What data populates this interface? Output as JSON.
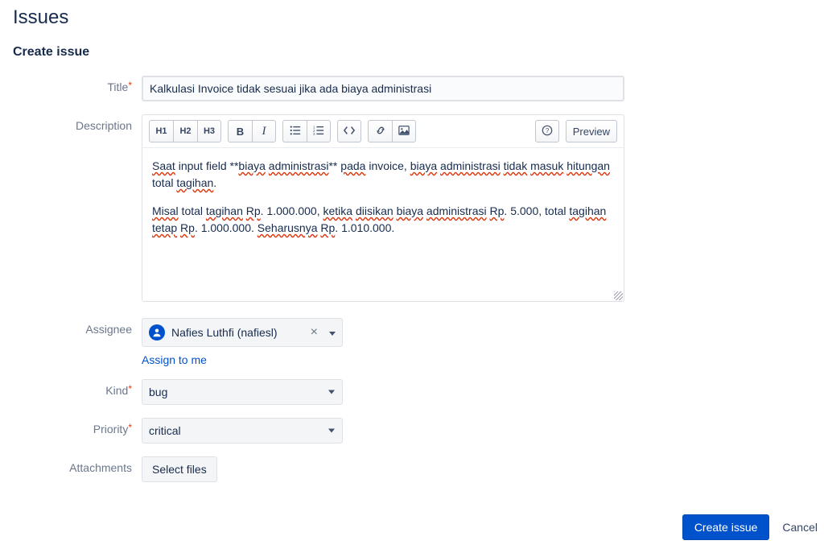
{
  "page": {
    "heading": "Issues",
    "section_title": "Create issue"
  },
  "form": {
    "title_label": "Title",
    "title_value": "Kalkulasi Invoice tidak sesuai jika ada biaya administrasi",
    "description_label": "Description",
    "description_text_p1": "Saat input field **biaya administrasi** pada invoice, biaya administrasi tidak masuk hitungan total tagihan.",
    "description_text_p2": "Misal total tagihan Rp. 1.000.000, ketika diisikan biaya administrasi Rp. 5.000, total tagihan tetap Rp. 1.000.000. Seharusnya Rp. 1.010.000.",
    "assignee_label": "Assignee",
    "assignee_value": "Nafies Luthfi (nafiesl)",
    "assign_to_me": "Assign to me",
    "kind_label": "Kind",
    "kind_value": "bug",
    "priority_label": "Priority",
    "priority_value": "critical",
    "attachments_label": "Attachments",
    "select_files_label": "Select files"
  },
  "toolbar": {
    "h1": "H1",
    "h2": "H2",
    "h3": "H3",
    "bold": "B",
    "italic": "I",
    "preview": "Preview"
  },
  "actions": {
    "create": "Create issue",
    "cancel": "Cancel"
  }
}
